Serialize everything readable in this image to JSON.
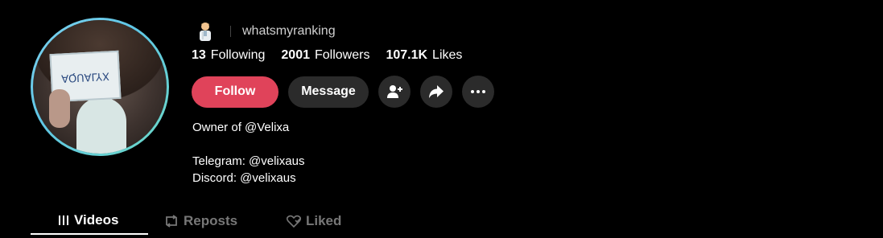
{
  "profile": {
    "username": "whatsmyranking",
    "badge_icon": "scientist-emoji-icon",
    "avatar_paper_text": "AQUALYX"
  },
  "stats": {
    "following": {
      "value": "13",
      "label": "Following"
    },
    "followers": {
      "value": "2001",
      "label": "Followers"
    },
    "likes": {
      "value": "107.1K",
      "label": "Likes"
    }
  },
  "actions": {
    "follow_label": "Follow",
    "message_label": "Message",
    "icons": [
      "add-friend-icon",
      "share-icon",
      "more-icon"
    ]
  },
  "bio": {
    "line1": "Owner of @Velixa",
    "line2": "Telegram: @velixaus",
    "line3": "Discord: @velixaus"
  },
  "tabs": [
    {
      "label": "Videos",
      "icon": "grid-icon"
    },
    {
      "label": "Reposts",
      "icon": "repost-icon"
    },
    {
      "label": "Liked",
      "icon": "heart-icon"
    }
  ],
  "colors": {
    "accent": "#e0435a",
    "background": "#000000",
    "button_dark": "#2b2b2b"
  }
}
